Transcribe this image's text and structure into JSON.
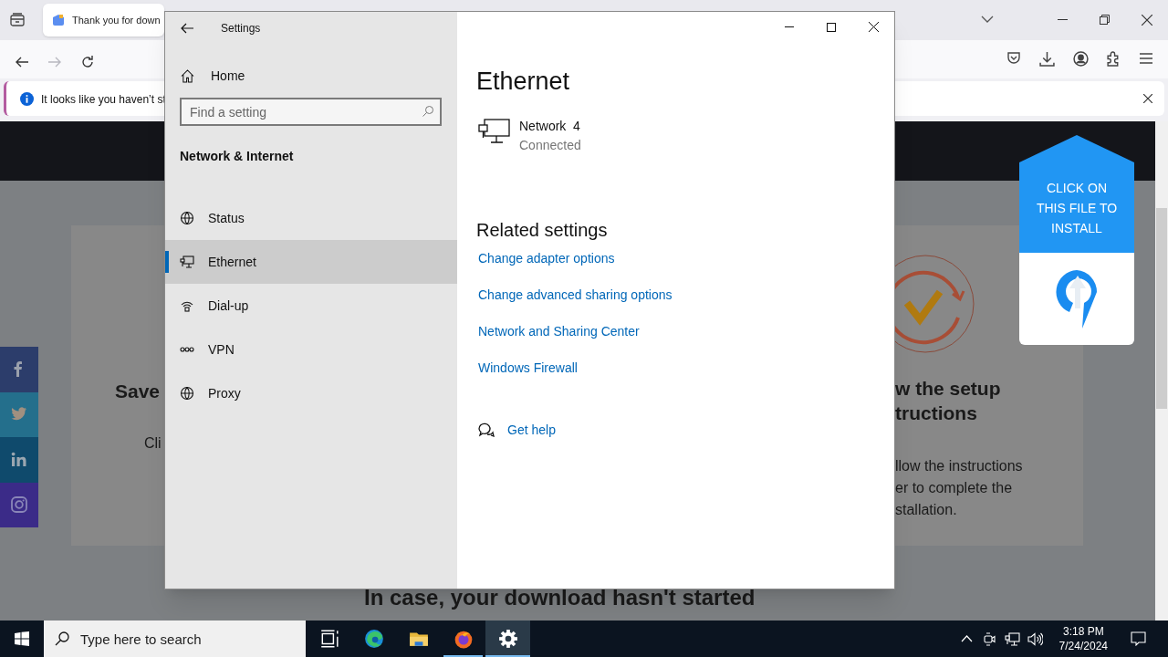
{
  "browser": {
    "tab": {
      "title": "Thank you for down"
    },
    "nav_buttons": [
      {
        "kind": "back",
        "disabled": false
      },
      {
        "kind": "forward",
        "disabled": true
      },
      {
        "kind": "reload",
        "disabled": false
      }
    ],
    "notification": {
      "text": "It looks like you haven’t st"
    }
  },
  "page": {
    "social": [
      {
        "kind": "facebook",
        "color": "#2c3d6b"
      },
      {
        "kind": "twitter",
        "color": "#246f8c"
      },
      {
        "kind": "linkedin",
        "color": "#0f4a6c"
      },
      {
        "kind": "instagram",
        "color": "#3b2b88"
      }
    ],
    "left_card": {
      "title": "Save",
      "text": "Cli"
    },
    "right_card": {
      "title_lines": [
        "w the setup",
        "tructions"
      ],
      "text_lines": [
        "llow the instructions",
        "er to complete the",
        "stallation."
      ]
    },
    "install_badge": {
      "text": "CLICK ON THIS FILE TO INSTALL"
    },
    "banner_text": "In case, your download hasn't started"
  },
  "settings": {
    "title": "Settings",
    "home": "Home",
    "search": {
      "placeholder": "Find a setting"
    },
    "section": "Network & Internet",
    "nav": [
      {
        "kind": "status",
        "label": "Status",
        "selected": false
      },
      {
        "kind": "ethernet",
        "label": "Ethernet",
        "selected": true
      },
      {
        "kind": "dialup",
        "label": "Dial-up",
        "selected": false
      },
      {
        "kind": "vpn",
        "label": "VPN",
        "selected": false
      },
      {
        "kind": "proxy",
        "label": "Proxy",
        "selected": false
      }
    ],
    "heading": "Ethernet",
    "network": {
      "name": "Network  4",
      "status": "Connected"
    },
    "related_heading": "Related settings",
    "links": [
      "Change adapter options",
      "Change advanced sharing options",
      "Network and Sharing Center",
      "Windows Firewall"
    ],
    "help": "Get help"
  },
  "taskbar": {
    "search_placeholder": "Type here to search",
    "apps": [
      {
        "kind": "taskview",
        "selected": false,
        "running": false
      },
      {
        "kind": "edge",
        "selected": false,
        "running": false
      },
      {
        "kind": "explorer",
        "selected": false,
        "running": false
      },
      {
        "kind": "firefox",
        "selected": false,
        "running": true
      },
      {
        "kind": "settings",
        "selected": true,
        "running": true
      }
    ],
    "time": "3:18 PM",
    "date": "7/24/2024"
  }
}
